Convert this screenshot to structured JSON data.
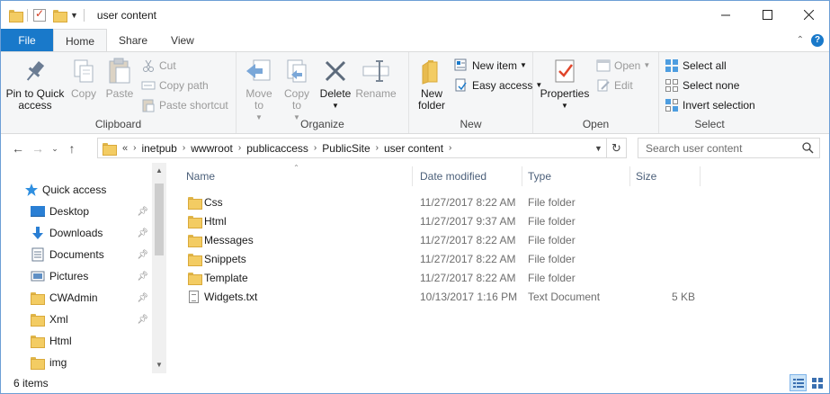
{
  "window": {
    "title": "user content"
  },
  "ribbon_tabs": [
    "File",
    "Home",
    "Share",
    "View"
  ],
  "ribbon": {
    "clipboard": {
      "label": "Clipboard",
      "pin": "Pin to Quick access",
      "copy": "Copy",
      "paste": "Paste",
      "cut": "Cut",
      "copy_path": "Copy path",
      "paste_shortcut": "Paste shortcut"
    },
    "organize": {
      "label": "Organize",
      "move_to": "Move to",
      "copy_to": "Copy to",
      "delete": "Delete",
      "rename": "Rename"
    },
    "new": {
      "label": "New",
      "new_folder": "New folder",
      "new_item": "New item",
      "easy_access": "Easy access"
    },
    "open": {
      "label": "Open",
      "properties": "Properties",
      "open": "Open",
      "edit": "Edit"
    },
    "select": {
      "label": "Select",
      "select_all": "Select all",
      "select_none": "Select none",
      "invert_selection": "Invert selection"
    }
  },
  "address": {
    "overflow": "«",
    "crumbs": [
      "inetpub",
      "wwwroot",
      "publicaccess",
      "PublicSite",
      "user content"
    ],
    "search_placeholder": "Search user content"
  },
  "nav_pane": {
    "quick_access": "Quick access",
    "items": [
      {
        "label": "Desktop",
        "icon": "desktop-icon",
        "pinned": true
      },
      {
        "label": "Downloads",
        "icon": "downloads-icon",
        "pinned": true
      },
      {
        "label": "Documents",
        "icon": "documents-icon",
        "pinned": true
      },
      {
        "label": "Pictures",
        "icon": "pictures-icon",
        "pinned": true
      },
      {
        "label": "CWAdmin",
        "icon": "folder-icon",
        "pinned": true
      },
      {
        "label": "Xml",
        "icon": "folder-icon",
        "pinned": true
      },
      {
        "label": "Html",
        "icon": "folder-icon",
        "pinned": false
      },
      {
        "label": "img",
        "icon": "folder-icon",
        "pinned": false
      }
    ]
  },
  "columns": {
    "name": "Name",
    "date_modified": "Date modified",
    "type": "Type",
    "size": "Size"
  },
  "files": [
    {
      "name": "Css",
      "date": "11/27/2017 8:22 AM",
      "type": "File folder",
      "size": "",
      "icon": "folder-icon"
    },
    {
      "name": "Html",
      "date": "11/27/2017 9:37 AM",
      "type": "File folder",
      "size": "",
      "icon": "folder-icon"
    },
    {
      "name": "Messages",
      "date": "11/27/2017 8:22 AM",
      "type": "File folder",
      "size": "",
      "icon": "folder-icon"
    },
    {
      "name": "Snippets",
      "date": "11/27/2017 8:22 AM",
      "type": "File folder",
      "size": "",
      "icon": "folder-icon"
    },
    {
      "name": "Template",
      "date": "11/27/2017 8:22 AM",
      "type": "File folder",
      "size": "",
      "icon": "folder-icon"
    },
    {
      "name": "Widgets.txt",
      "date": "10/13/2017 1:16 PM",
      "type": "Text Document",
      "size": "5 KB",
      "icon": "text-file-icon"
    }
  ],
  "status": {
    "item_count": "6 items"
  },
  "colors": {
    "accent": "#1979ca",
    "folder": "#f3cc63",
    "header_text": "#4c607a"
  }
}
